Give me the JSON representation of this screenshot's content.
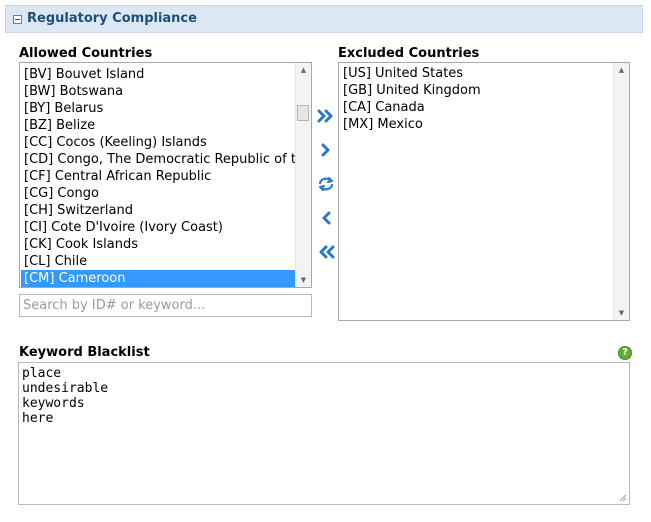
{
  "section": {
    "title": "Regulatory Compliance"
  },
  "allowed": {
    "label": "Allowed Countries",
    "items": [
      {
        "text": "[BV] Bouvet Island"
      },
      {
        "text": "[BW] Botswana"
      },
      {
        "text": "[BY] Belarus"
      },
      {
        "text": "[BZ] Belize"
      },
      {
        "text": "[CC] Cocos (Keeling) Islands"
      },
      {
        "text": "[CD] Congo, The Democratic Republic of the"
      },
      {
        "text": "[CF] Central African Republic"
      },
      {
        "text": "[CG] Congo"
      },
      {
        "text": "[CH] Switzerland"
      },
      {
        "text": "[CI] Cote D'Ivoire (Ivory Coast)"
      },
      {
        "text": "[CK] Cook Islands"
      },
      {
        "text": "[CL] Chile"
      },
      {
        "text": "[CM] Cameroon"
      }
    ],
    "selected_item": "[CM] Cameroon"
  },
  "excluded": {
    "label": "Excluded Countries",
    "items": [
      {
        "text": "[US] United States"
      },
      {
        "text": "[GB] United Kingdom"
      },
      {
        "text": "[CA] Canada"
      },
      {
        "text": "[MX] Mexico"
      }
    ]
  },
  "transfer_buttons": [
    {
      "name": "move-all-right-button",
      "icon": "double-chevron-right-icon"
    },
    {
      "name": "move-right-button",
      "icon": "chevron-right-icon"
    },
    {
      "name": "reset-button",
      "icon": "refresh-icon"
    },
    {
      "name": "move-left-button",
      "icon": "chevron-left-icon"
    },
    {
      "name": "move-all-left-button",
      "icon": "double-chevron-left-icon"
    }
  ],
  "search": {
    "placeholder": "Search by ID# or keyword...",
    "value": ""
  },
  "keywords": {
    "label": "Keyword Blacklist",
    "value": "place\nundesirable\nkeywords\nhere",
    "help_icon": "help-icon"
  },
  "colors": {
    "header_bg": "#dbe8f4",
    "title_color": "#1f4e79",
    "selection": "#3399ff",
    "arrow_blue": "#2a78c8",
    "help_green": "#5fae34"
  }
}
